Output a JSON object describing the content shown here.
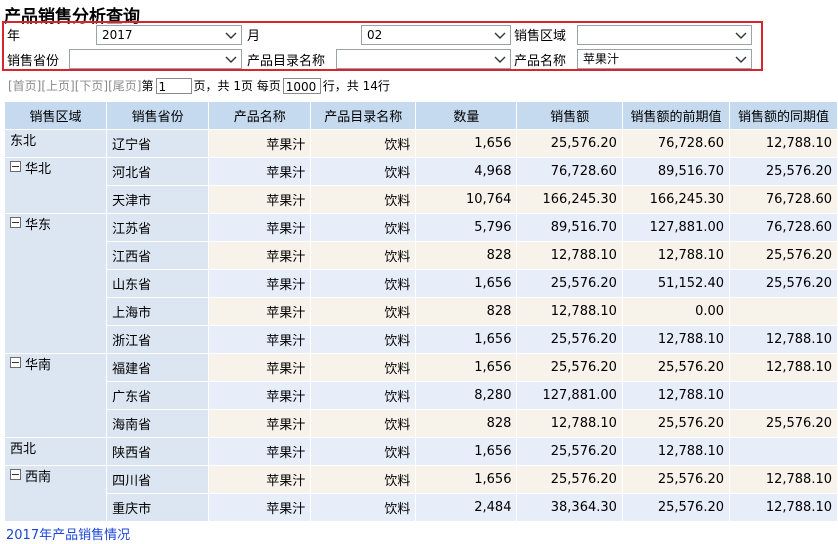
{
  "title": "产品销售分析查询",
  "filters": {
    "year_label": "年",
    "year_value": "2017",
    "month_label": "月",
    "month_value": "02",
    "region_label": "销售区域",
    "region_value": "",
    "province_label": "销售省份",
    "province_value": "",
    "category_label": "产品目录名称",
    "category_value": "",
    "product_label": "产品名称",
    "product_value": "苹果汁"
  },
  "pager": {
    "first": "[首页]",
    "prev": "[上页]",
    "next": "[下页]",
    "last": "[尾页]",
    "goto_prefix": "第",
    "page_input": "1",
    "page_suffix": "页，共 1页 每页",
    "size_input": "1000",
    "rows_suffix": "行，共 14行"
  },
  "table": {
    "columns": [
      "销售区域",
      "销售省份",
      "产品名称",
      "产品目录名称",
      "数量",
      "销售额",
      "销售额的前期值",
      "销售额的同期值"
    ],
    "groups": [
      {
        "region": "东北",
        "expanded": false,
        "rows": [
          {
            "province": "辽宁省",
            "product": "苹果汁",
            "category": "饮料",
            "qty": "1,656",
            "sales": "25,576.20",
            "prev": "76,728.60",
            "same": "12,788.10"
          }
        ]
      },
      {
        "region": "华北",
        "expanded": true,
        "rows": [
          {
            "province": "河北省",
            "product": "苹果汁",
            "category": "饮料",
            "qty": "4,968",
            "sales": "76,728.60",
            "prev": "89,516.70",
            "same": "25,576.20"
          },
          {
            "province": "天津市",
            "product": "苹果汁",
            "category": "饮料",
            "qty": "10,764",
            "sales": "166,245.30",
            "prev": "166,245.30",
            "same": "76,728.60"
          }
        ]
      },
      {
        "region": "华东",
        "expanded": true,
        "rows": [
          {
            "province": "江苏省",
            "product": "苹果汁",
            "category": "饮料",
            "qty": "5,796",
            "sales": "89,516.70",
            "prev": "127,881.00",
            "same": "76,728.60"
          },
          {
            "province": "江西省",
            "product": "苹果汁",
            "category": "饮料",
            "qty": "828",
            "sales": "12,788.10",
            "prev": "12,788.10",
            "same": "25,576.20"
          },
          {
            "province": "山东省",
            "product": "苹果汁",
            "category": "饮料",
            "qty": "1,656",
            "sales": "25,576.20",
            "prev": "51,152.40",
            "same": "25,576.20"
          },
          {
            "province": "上海市",
            "product": "苹果汁",
            "category": "饮料",
            "qty": "828",
            "sales": "12,788.10",
            "prev": "0.00",
            "same": ""
          },
          {
            "province": "浙江省",
            "product": "苹果汁",
            "category": "饮料",
            "qty": "1,656",
            "sales": "25,576.20",
            "prev": "12,788.10",
            "same": "12,788.10"
          }
        ]
      },
      {
        "region": "华南",
        "expanded": true,
        "rows": [
          {
            "province": "福建省",
            "product": "苹果汁",
            "category": "饮料",
            "qty": "1,656",
            "sales": "25,576.20",
            "prev": "25,576.20",
            "same": "12,788.10"
          },
          {
            "province": "广东省",
            "product": "苹果汁",
            "category": "饮料",
            "qty": "8,280",
            "sales": "127,881.00",
            "prev": "12,788.10",
            "same": ""
          },
          {
            "province": "海南省",
            "product": "苹果汁",
            "category": "饮料",
            "qty": "828",
            "sales": "12,788.10",
            "prev": "25,576.20",
            "same": "25,576.20"
          }
        ]
      },
      {
        "region": "西北",
        "expanded": false,
        "rows": [
          {
            "province": "陕西省",
            "product": "苹果汁",
            "category": "饮料",
            "qty": "1,656",
            "sales": "25,576.20",
            "prev": "12,788.10",
            "same": ""
          }
        ]
      },
      {
        "region": "西南",
        "expanded": true,
        "rows": [
          {
            "province": "四川省",
            "product": "苹果汁",
            "category": "饮料",
            "qty": "1,656",
            "sales": "25,576.20",
            "prev": "25,576.20",
            "same": "12,788.10"
          },
          {
            "province": "重庆市",
            "product": "苹果汁",
            "category": "饮料",
            "qty": "2,484",
            "sales": "38,364.30",
            "prev": "25,576.20",
            "same": "12,788.10"
          }
        ]
      }
    ]
  },
  "footer_link": "2017年产品销售情况",
  "colors": {
    "accent": "#d9232d",
    "header": "#c5d9ef",
    "dim_cell": "#dce6f2",
    "link": "#1b46d8"
  },
  "icons": {
    "dropdown": "chevron-down-icon",
    "collapse": "minus-icon"
  }
}
